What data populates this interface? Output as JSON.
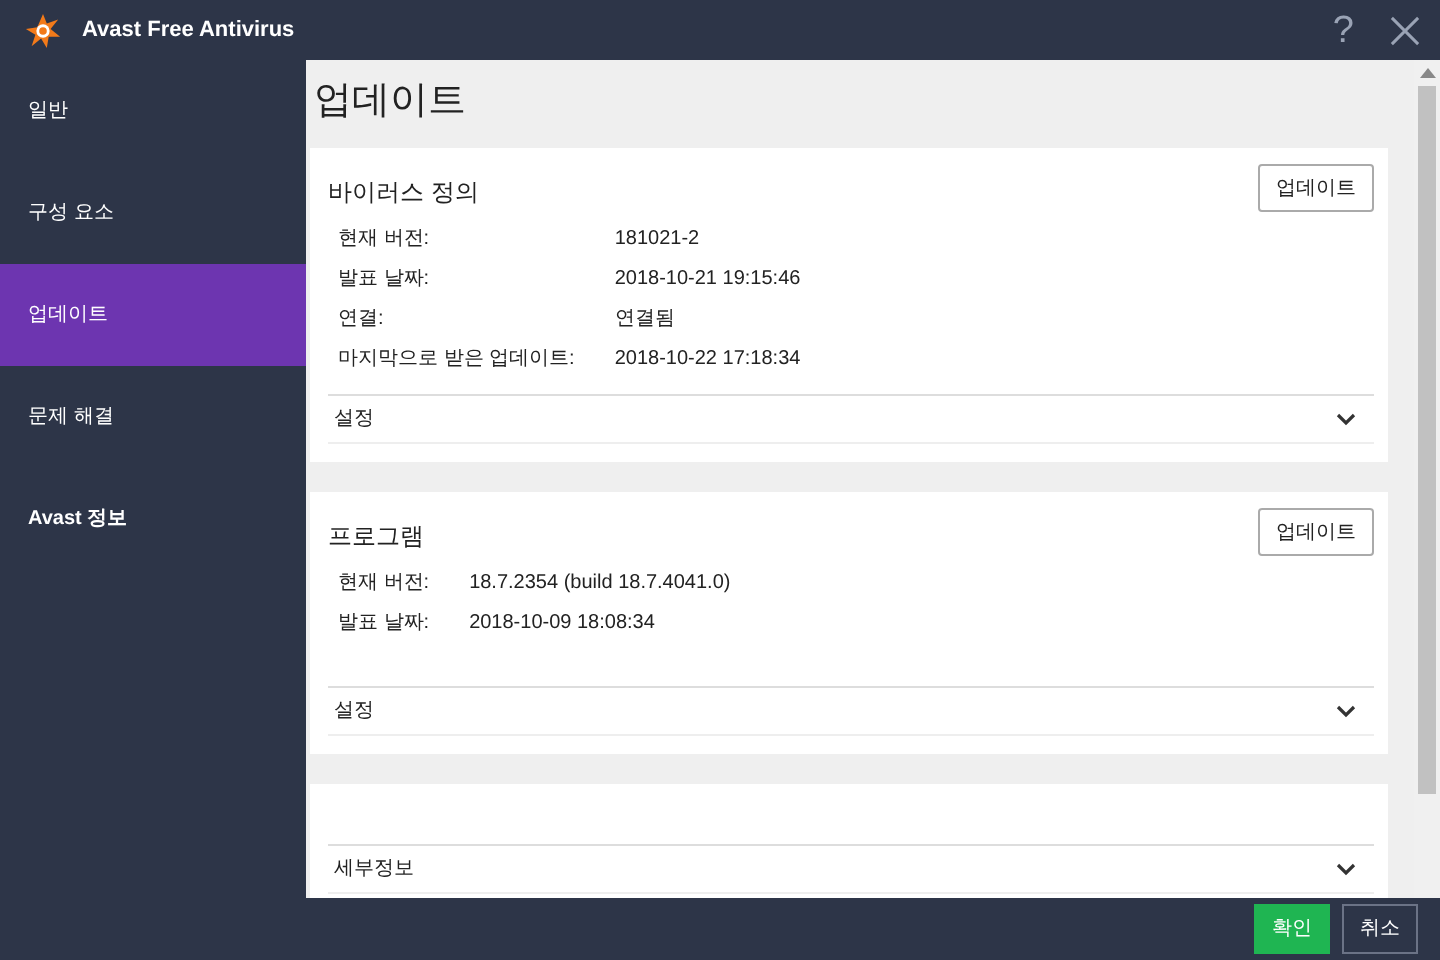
{
  "window": {
    "title": "Avast Free Antivirus",
    "help": "?"
  },
  "sidebar": {
    "items": [
      {
        "label": "일반",
        "selected": false
      },
      {
        "label": "구성 요소",
        "selected": false
      },
      {
        "label": "업데이트",
        "selected": true
      },
      {
        "label": "문제 해결",
        "selected": false
      },
      {
        "label": "Avast 정보",
        "selected": false
      }
    ]
  },
  "page_title": "업데이트",
  "sections": [
    {
      "title": "바이러스 정의",
      "button": "업데이트",
      "fields": [
        {
          "label": "현재 버전:",
          "value": "181021-2"
        },
        {
          "label": "발표 날짜:",
          "value": "2018-10-21 19:15:46"
        },
        {
          "label": "연결:",
          "value": "연결됨"
        },
        {
          "label": "마지막으로 받은 업데이트:",
          "value": "2018-10-22 17:18:34"
        }
      ],
      "expander": "설정"
    },
    {
      "title": "프로그램",
      "button": "업데이트",
      "fields": [
        {
          "label": "현재 버전:",
          "value": "18.7.2354 (build 18.7.4041.0)"
        },
        {
          "label": "발표 날짜:",
          "value": "2018-10-09 18:08:34"
        }
      ],
      "expander": "설정"
    },
    {
      "expander": "세부정보"
    }
  ],
  "footer": {
    "buttons": [
      {
        "label": "확인",
        "kind": "primary"
      },
      {
        "label": "취소",
        "kind": "secondary"
      }
    ]
  }
}
